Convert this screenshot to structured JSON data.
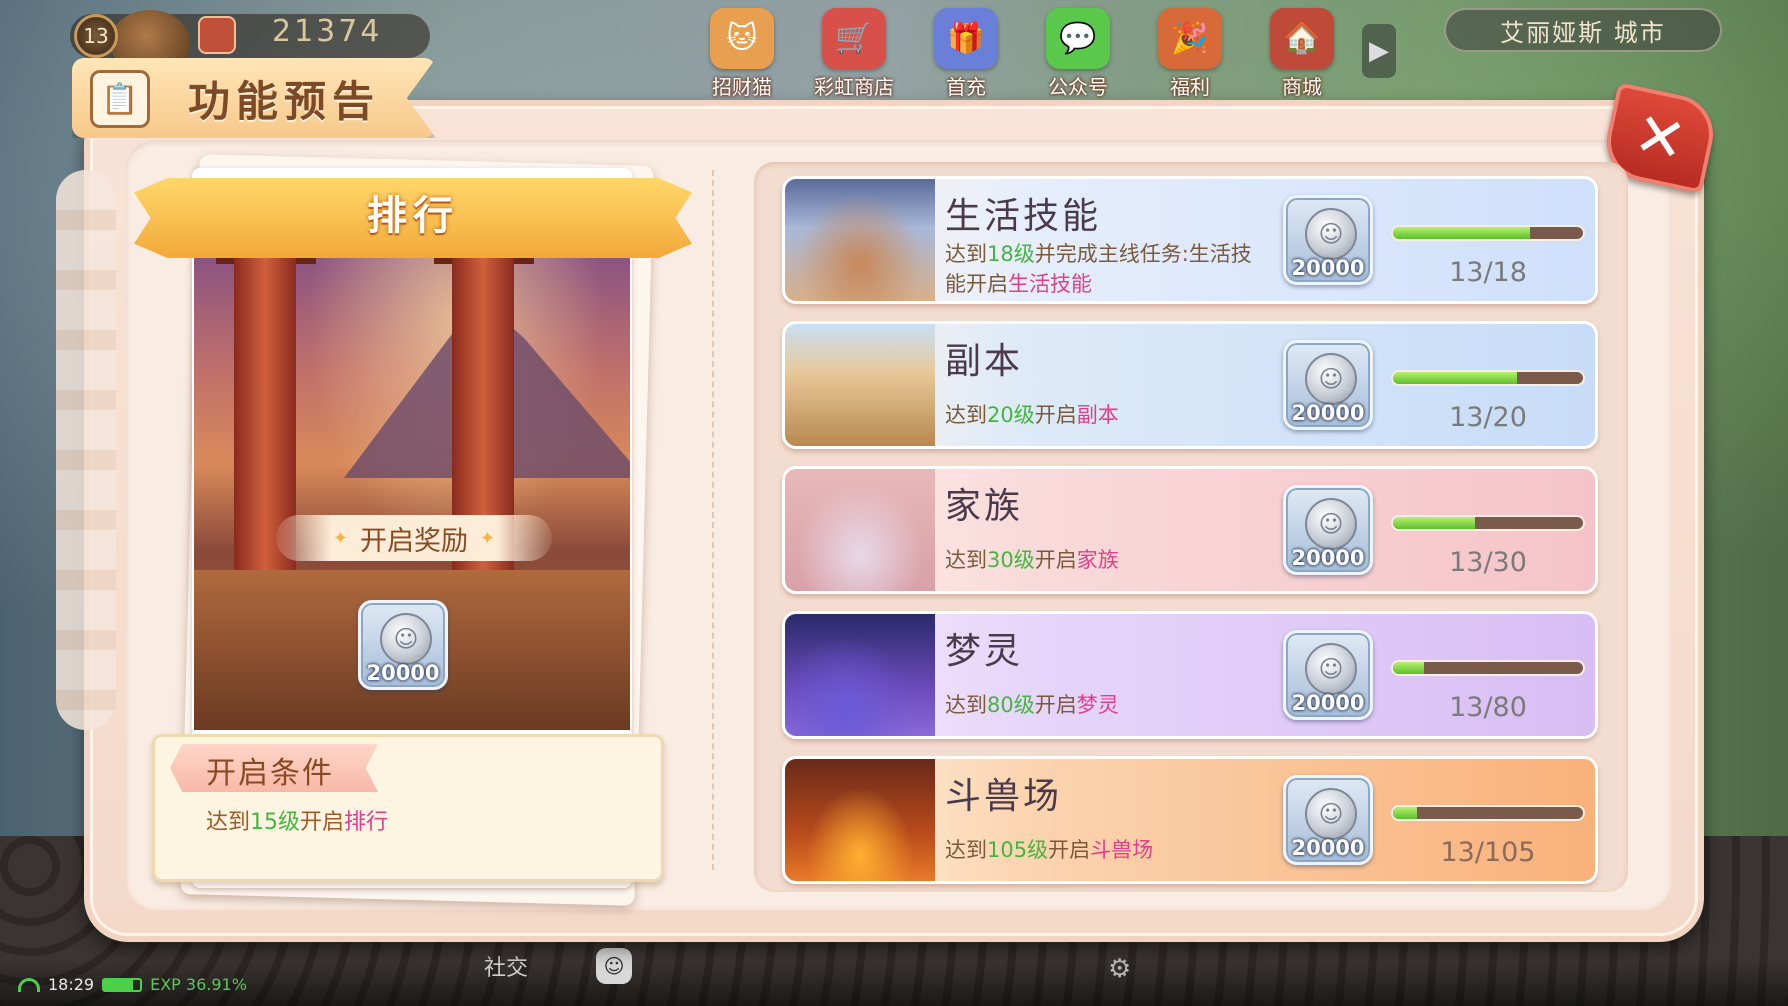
{
  "hud": {
    "level": "13",
    "currency_value": "21374",
    "location": "艾丽娅斯 城市",
    "top_menu": [
      {
        "label": "招财猫",
        "icon": "lucky-cat-icon",
        "color": "#e8a050"
      },
      {
        "label": "彩虹商店",
        "icon": "rainbow-shop-icon",
        "color": "#d8504a"
      },
      {
        "label": "首充",
        "icon": "first-recharge-icon",
        "color": "#6a80d8"
      },
      {
        "label": "公众号",
        "icon": "wechat-icon",
        "color": "#5ac84a"
      },
      {
        "label": "福利",
        "icon": "welfare-gift-icon",
        "color": "#d86a3a"
      },
      {
        "label": "商城",
        "icon": "mall-house-icon",
        "color": "#c04a3a"
      }
    ],
    "clock": "18:29",
    "exp": "EXP 36.91%",
    "social_label": "社交"
  },
  "dialog": {
    "title": "功能预告",
    "close_label": "✕"
  },
  "featured": {
    "name": "排行",
    "reward_label": "开启奖励",
    "reward_amount": "20000",
    "condition_title": "开启条件",
    "condition": {
      "prefix": "达到",
      "level": "15级",
      "middle": "开启",
      "feature": "排行"
    }
  },
  "features": [
    {
      "name": "生活技能",
      "desc_prefix": "达到",
      "desc_level": "18级",
      "desc_middle": "并完成主线任务:生活技能开启",
      "desc_feature": "生活技能",
      "reward": "20000",
      "current": 13,
      "required": 18,
      "progress_text": "13/18"
    },
    {
      "name": "副本",
      "desc_prefix": "达到",
      "desc_level": "20级",
      "desc_middle": "开启",
      "desc_feature": "副本",
      "reward": "20000",
      "current": 13,
      "required": 20,
      "progress_text": "13/20"
    },
    {
      "name": "家族",
      "desc_prefix": "达到",
      "desc_level": "30级",
      "desc_middle": "开启",
      "desc_feature": "家族",
      "reward": "20000",
      "current": 13,
      "required": 30,
      "progress_text": "13/30"
    },
    {
      "name": "梦灵",
      "desc_prefix": "达到",
      "desc_level": "80级",
      "desc_middle": "开启",
      "desc_feature": "梦灵",
      "reward": "20000",
      "current": 13,
      "required": 80,
      "progress_text": "13/80"
    },
    {
      "name": "斗兽场",
      "desc_prefix": "达到",
      "desc_level": "105级",
      "desc_middle": "开启",
      "desc_feature": "斗兽场",
      "reward": "20000",
      "current": 13,
      "required": 105,
      "progress_text": "13/105"
    }
  ],
  "colors": {
    "level_highlight": "#44b540",
    "feature_highlight": "#e0408a",
    "close_button": "#c8352a",
    "banner": "#f7b84a"
  }
}
